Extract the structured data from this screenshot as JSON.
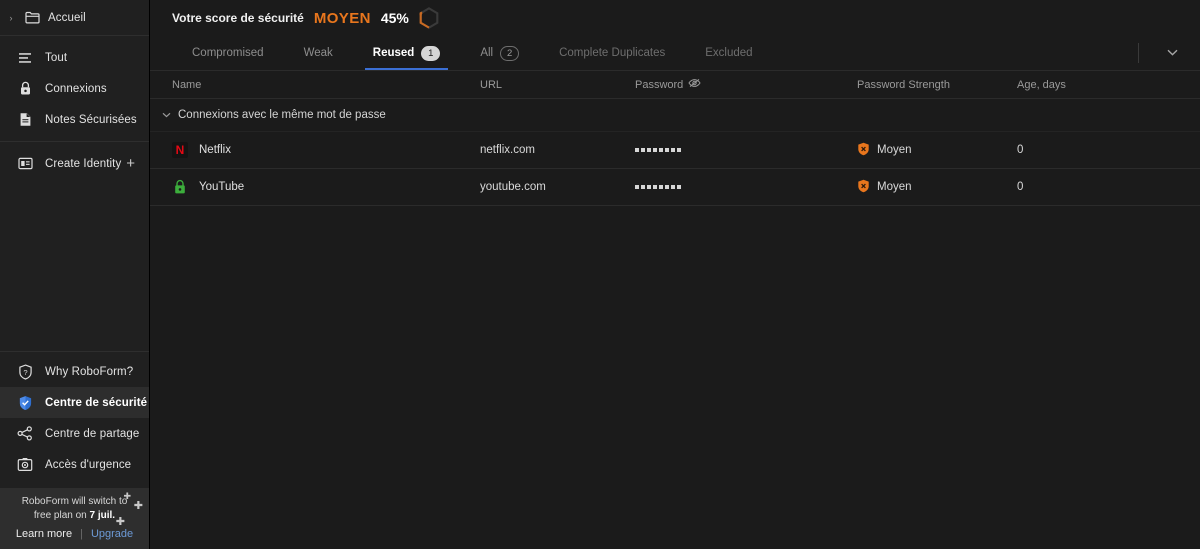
{
  "sidebar": {
    "home": {
      "label": "Accueil",
      "icon": "folder-icon",
      "caret": "›"
    },
    "groups": [
      {
        "items": [
          {
            "label": "Tout",
            "icon": "list-icon"
          },
          {
            "label": "Connexions",
            "icon": "lock-icon"
          },
          {
            "label": "Notes Sécurisées",
            "icon": "note-icon"
          }
        ]
      }
    ],
    "create": {
      "label": "Create Identity",
      "icon": "identity-card-icon",
      "plus": "+"
    },
    "bottom_items": [
      {
        "label": "Why RoboForm?",
        "icon": "question-shield-icon",
        "active": false
      },
      {
        "label": "Centre de sécurité",
        "icon": "security-shield-icon",
        "active": true
      },
      {
        "label": "Centre de partage",
        "icon": "share-icon",
        "active": false
      },
      {
        "label": "Accès d'urgence",
        "icon": "emergency-icon",
        "active": false
      }
    ],
    "promo": {
      "line1": "RoboForm will switch to",
      "line2_pre": "free plan on ",
      "line2_bold": "7 juil.",
      "learn_more": "Learn more",
      "divider": "|",
      "upgrade": "Upgrade"
    }
  },
  "header": {
    "score_label": "Votre score de sécurité",
    "score_level": "MOYEN",
    "score_percent": "45%",
    "score_value": 45,
    "score_color": "#e8761d",
    "ring_track_color": "#3a3a3a"
  },
  "tabs": [
    {
      "label": "Compromised",
      "badge": null,
      "active": false,
      "dim": false
    },
    {
      "label": "Weak",
      "badge": null,
      "active": false,
      "dim": false
    },
    {
      "label": "Reused",
      "badge": "1",
      "active": true,
      "dim": false
    },
    {
      "label": "All",
      "badge": "2",
      "active": false,
      "dim": false
    },
    {
      "label": "Complete Duplicates",
      "badge": null,
      "active": false,
      "dim": true
    },
    {
      "label": "Excluded",
      "badge": null,
      "active": false,
      "dim": true
    }
  ],
  "tabbar": {
    "chevron": "⌄",
    "chevron_icon": "chevron-down-icon"
  },
  "table": {
    "columns": {
      "name": "Name",
      "url": "URL",
      "password": "Password",
      "password_icon": "eye-off-icon",
      "strength": "Password Strength",
      "age": "Age, days"
    },
    "group": {
      "caret": "⌄",
      "label": "Connexions avec le même mot de passe"
    },
    "rows": [
      {
        "name": "Netflix",
        "icon": "netflix-icon",
        "icon_letter": "N",
        "url": "netflix.com",
        "password_mask_length": 8,
        "strength": "Moyen",
        "strength_icon": "shield-warning-icon",
        "strength_color": "#e8761d",
        "age": "0"
      },
      {
        "name": "YouTube",
        "icon": "green-lock-icon",
        "icon_letter": "",
        "url": "youtube.com",
        "password_mask_length": 8,
        "strength": "Moyen",
        "strength_icon": "shield-warning-icon",
        "strength_color": "#e8761d",
        "age": "0"
      }
    ]
  }
}
